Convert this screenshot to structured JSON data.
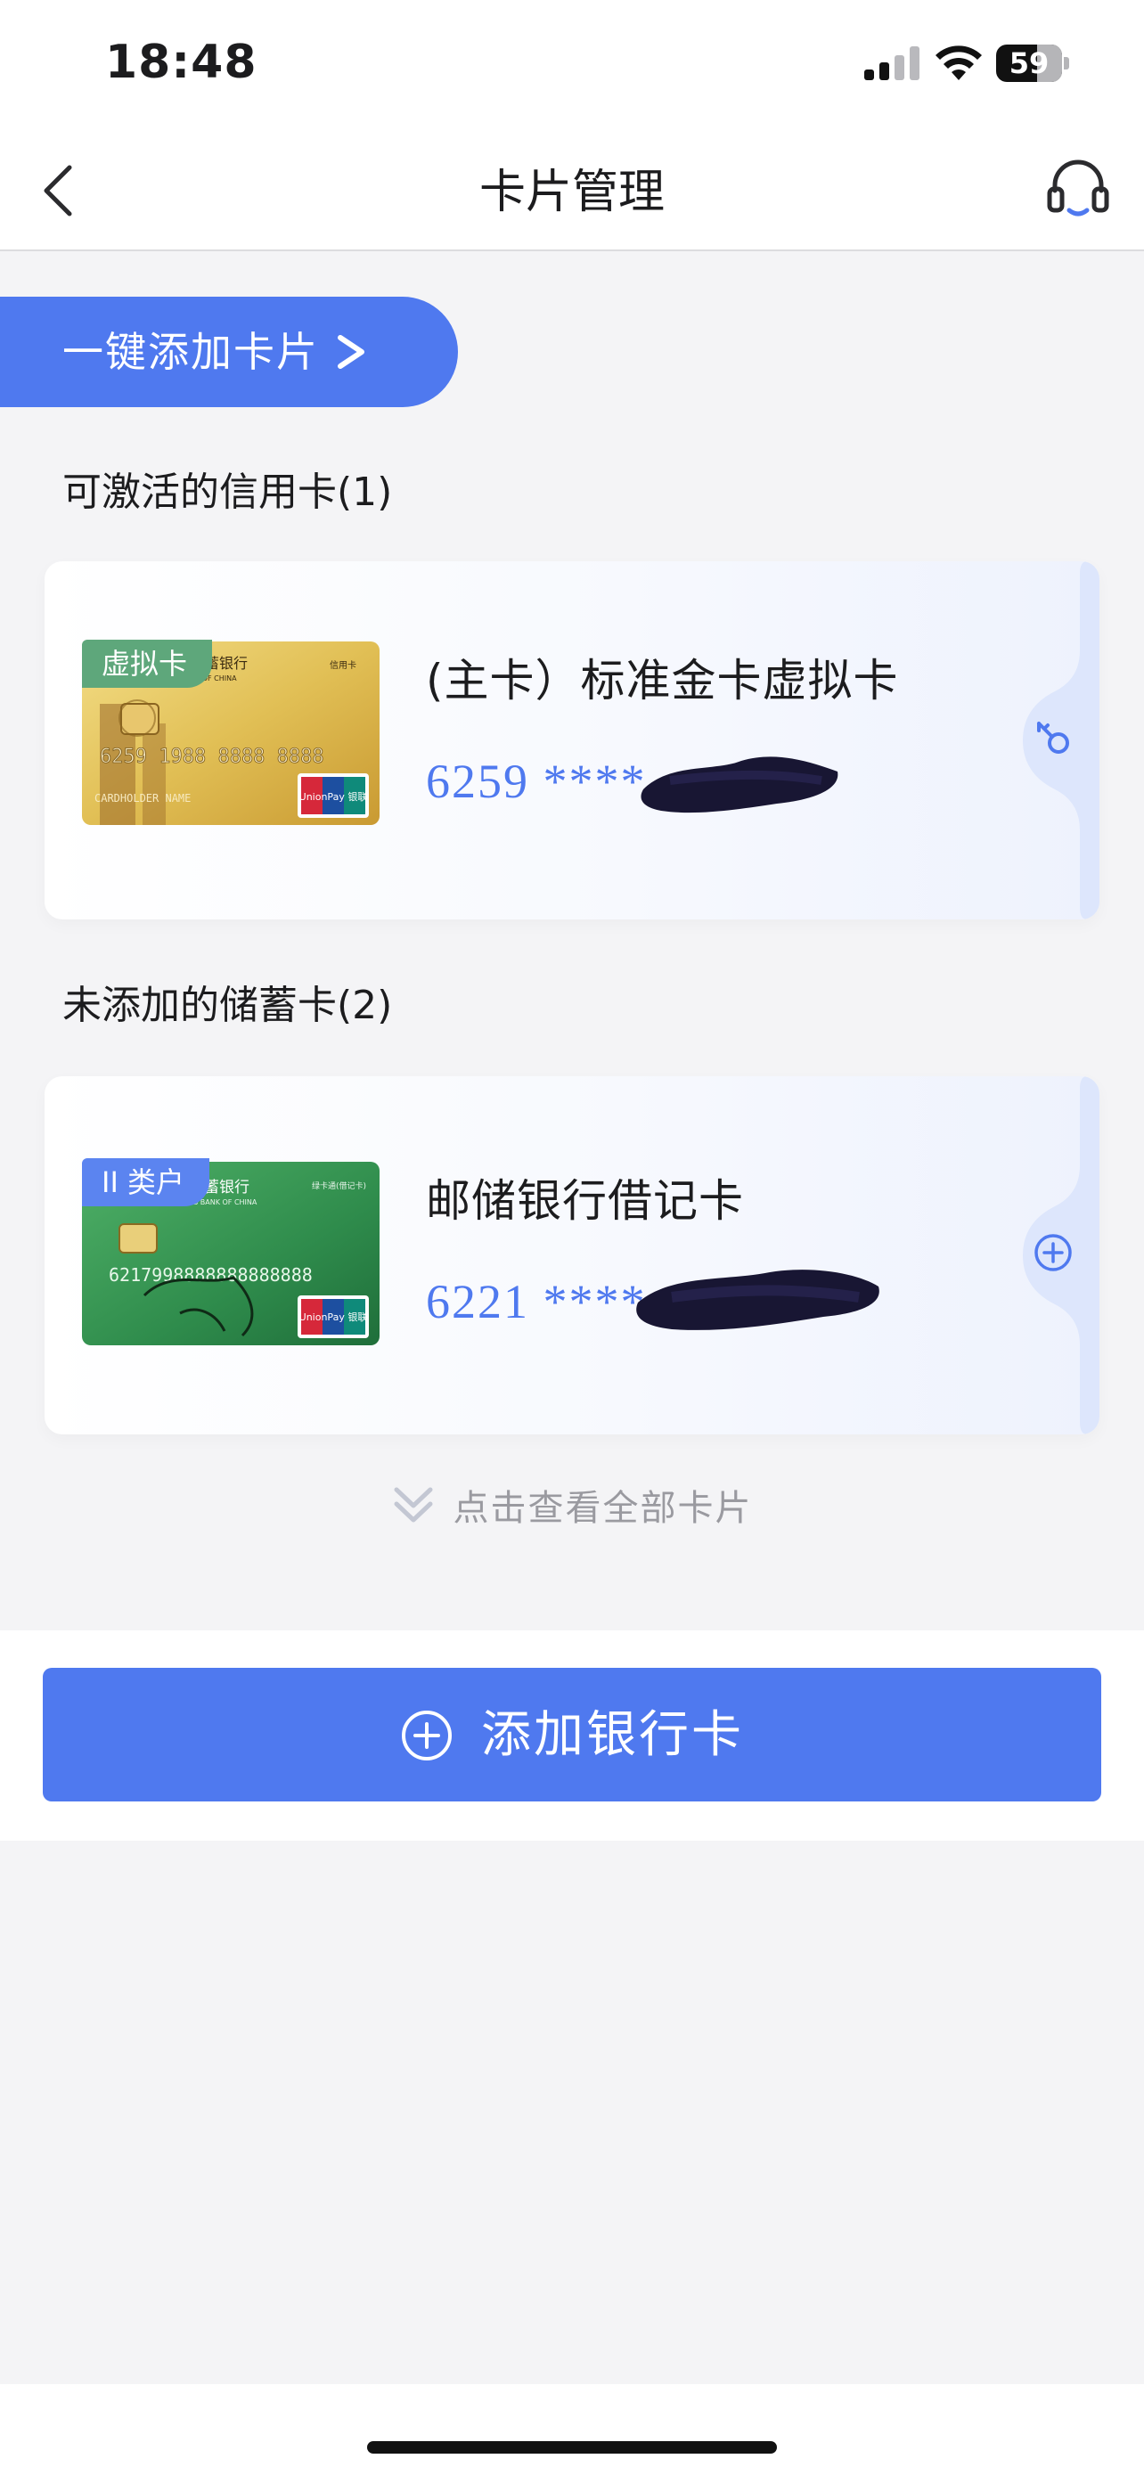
{
  "status_bar": {
    "time": "18:48",
    "battery_level": "59",
    "icons": [
      "cellular-signal-icon",
      "wifi-icon",
      "battery-icon"
    ]
  },
  "nav": {
    "title": "卡片管理",
    "back_icon": "chevron-left-icon",
    "support_icon": "headset-icon"
  },
  "quick_add": {
    "label": "一键添加卡片",
    "arrow_icon": "chevron-right-icon"
  },
  "credit_section": {
    "title": "可激活的信用卡(1)",
    "cards": [
      {
        "tag": "虚拟卡",
        "name": "(主卡）标准金卡虚拟卡",
        "number_masked": "6259 ****",
        "action_icon": "key-icon",
        "card_text": {
          "bank": "蓄银行",
          "bank_en": "BANK OF CHINA",
          "type": "信用卡",
          "number": "6259 1988 8888 8888",
          "holder": "CARDHOLDER NAME",
          "logo": "UnionPay 银联"
        }
      }
    ]
  },
  "debit_section": {
    "title": "未添加的储蓄卡(2)",
    "cards": [
      {
        "tag": "II 类户",
        "name": "邮储银行借记卡",
        "number_masked": "6221 ****",
        "action_icon": "plus-circle-icon",
        "card_text": {
          "bank": "储蓄银行",
          "bank_en": "POSTAL SAVINGS BANK OF CHINA",
          "type": "绿卡通(借记卡)",
          "number": "6217998888888888888",
          "logo": "UnionPay 银联"
        }
      }
    ]
  },
  "view_all": {
    "label": "点击查看全部卡片",
    "icon": "double-chevron-down-icon"
  },
  "add_bank_card": {
    "label": "添加银行卡",
    "icon": "plus-circle-icon"
  },
  "colors": {
    "accent": "#4f79ef",
    "virtual_tag": "#5ea77b",
    "class2_tag": "#5b84f0",
    "background": "#f4f4f6"
  }
}
